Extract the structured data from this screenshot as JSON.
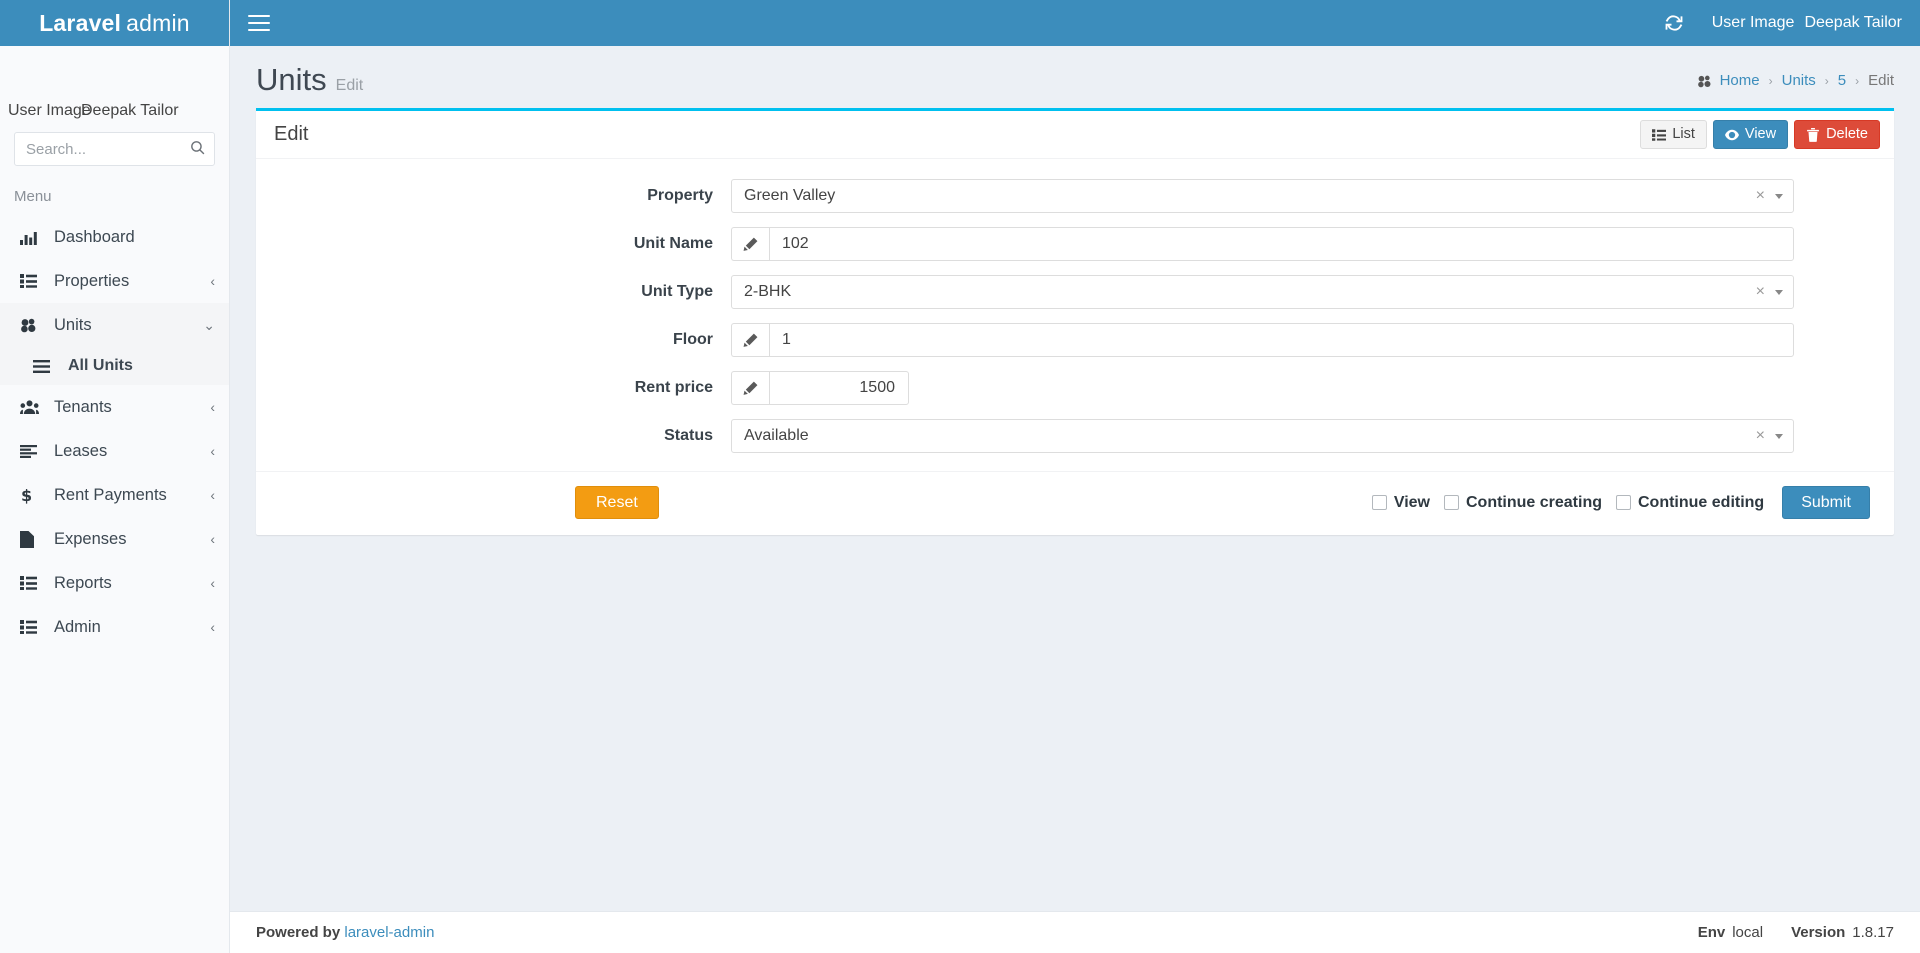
{
  "brand": {
    "strong": "Laravel",
    "light": "admin"
  },
  "topbar": {
    "refresh_icon": "refresh-icon",
    "user_image_alt": "User Image",
    "user_name": "Deepak Tailor"
  },
  "sidebar": {
    "user_image_alt": "User Image",
    "user_name": "Deepak Tailor",
    "user_sub": "-",
    "search": {
      "placeholder": "Search...",
      "value": ""
    },
    "menu_header": "Menu",
    "items": [
      {
        "label": "Dashboard",
        "icon": "bar-chart-icon",
        "chevron": "",
        "active": false
      },
      {
        "label": "Properties",
        "icon": "list-icon",
        "chevron": "‹",
        "active": false
      },
      {
        "label": "Units",
        "icon": "cubes-icon",
        "chevron": "⌄",
        "active": true
      },
      {
        "label": "Tenants",
        "icon": "users-icon",
        "chevron": "‹",
        "active": false
      },
      {
        "label": "Leases",
        "icon": "align-left-icon",
        "chevron": "‹",
        "active": false
      },
      {
        "label": "Rent Payments",
        "icon": "dollar-icon",
        "chevron": "‹",
        "active": false
      },
      {
        "label": "Expenses",
        "icon": "file-icon",
        "chevron": "‹",
        "active": false
      },
      {
        "label": "Reports",
        "icon": "list-icon",
        "chevron": "‹",
        "active": false
      },
      {
        "label": "Admin",
        "icon": "list-icon",
        "chevron": "‹",
        "active": false
      }
    ],
    "submenu": [
      {
        "label": "All Units",
        "icon": "bars-icon"
      }
    ]
  },
  "page": {
    "title": "Units",
    "subtitle": "Edit",
    "breadcrumb": [
      {
        "label": "Home",
        "link": true
      },
      {
        "label": "Units",
        "link": true
      },
      {
        "label": "5",
        "link": true
      },
      {
        "label": "Edit",
        "link": false
      }
    ]
  },
  "card": {
    "title": "Edit",
    "buttons": {
      "list": {
        "label": "List",
        "icon": "list-icon"
      },
      "view": {
        "label": "View",
        "icon": "eye-icon"
      },
      "delete": {
        "label": "Delete",
        "icon": "trash-icon"
      }
    }
  },
  "form": {
    "fields": [
      {
        "label": "Property",
        "type": "select",
        "value": "Green Valley",
        "clear": "×"
      },
      {
        "label": "Unit Name",
        "type": "text",
        "value": "102",
        "icon": "pencil-icon"
      },
      {
        "label": "Unit Type",
        "type": "select",
        "value": "2-BHK",
        "clear": "×"
      },
      {
        "label": "Floor",
        "type": "text",
        "value": "1",
        "icon": "pencil-icon"
      },
      {
        "label": "Rent price",
        "type": "number",
        "value": "1500",
        "icon": "pencil-icon"
      },
      {
        "label": "Status",
        "type": "select",
        "value": "Available",
        "clear": "×"
      }
    ],
    "reset_label": "Reset",
    "submit_label": "Submit",
    "checkboxes": [
      {
        "label": "View",
        "checked": false
      },
      {
        "label": "Continue creating",
        "checked": false
      },
      {
        "label": "Continue editing",
        "checked": false
      }
    ]
  },
  "footer": {
    "powered_by": "Powered by",
    "link": "laravel-admin",
    "env_label": "Env",
    "env_value": "local",
    "version_label": "Version",
    "version_value": "1.8.17"
  },
  "colors": {
    "brand_blue": "#3c8dbc",
    "accent_cyan": "#00c0ef",
    "danger_red": "#dd4b39",
    "warning_orange": "#f39c12"
  }
}
